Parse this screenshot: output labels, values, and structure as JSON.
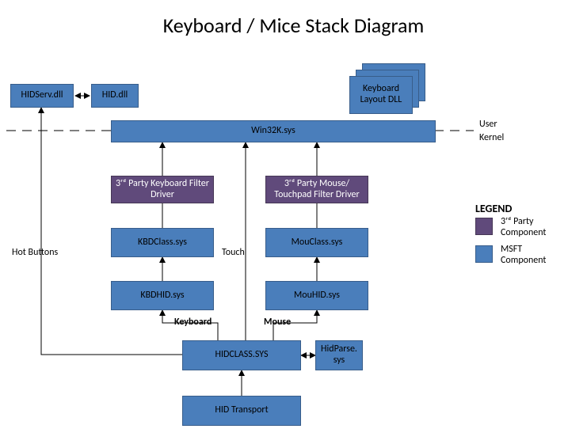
{
  "title": "Keyboard / Mice Stack Diagram",
  "boxes": {
    "hidserv": "HIDServ.dll",
    "hiddll": "HID.dll",
    "kbdlayout": "Keyboard Layout DLL",
    "win32k": "Win32K.sys",
    "kb_filter": "3ʳᵈ Party Keyboard Filter Driver",
    "ms_filter": "3ʳᵈ Party Mouse/ Touchpad Filter Driver",
    "kbdclass": "KBDClass.sys",
    "mouclass": "MouClass.sys",
    "kbdhid": "KBDHID.sys",
    "mouhid": "MouHID.sys",
    "hidclass": "HIDCLASS.SYS",
    "hidparse": "HidParse. sys",
    "hidtransport": "HID Transport"
  },
  "labels": {
    "user": "User",
    "kernel": "Kernel",
    "hot_buttons": "Hot Buttons",
    "touch": "Touch",
    "keyboard": "Keyboard",
    "mouse": "Mouse"
  },
  "legend": {
    "title": "LEGEND",
    "third": "3ʳᵈ Party Component",
    "msft": "MSFT Component"
  },
  "colors": {
    "msft_fill": "#4a7ebb",
    "msft_stroke": "#385d8a",
    "third_fill": "#604a7b",
    "third_stroke": "#463755"
  }
}
